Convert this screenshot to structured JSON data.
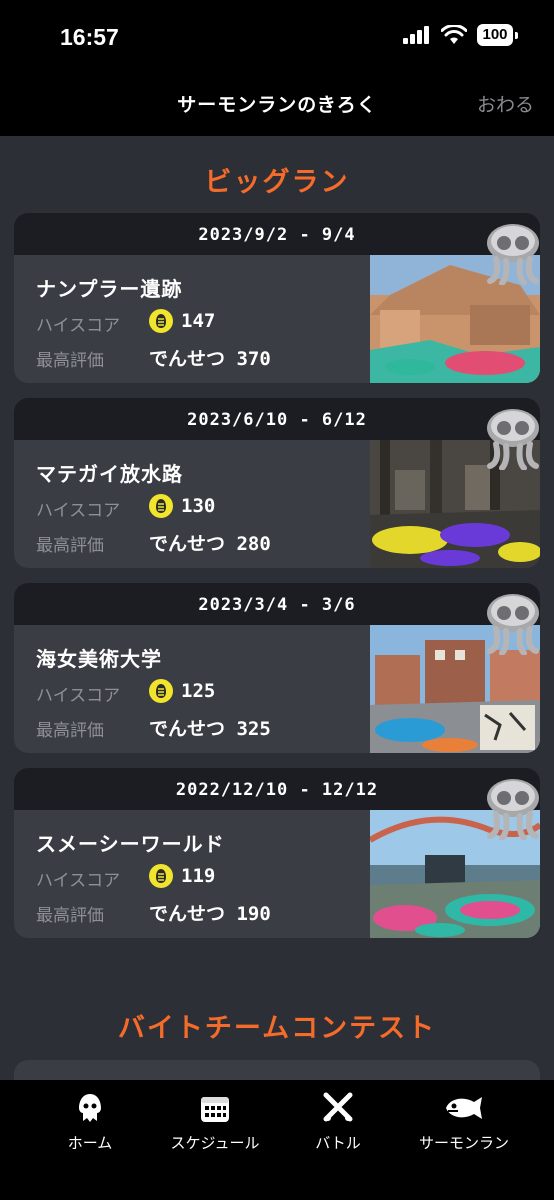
{
  "status": {
    "time": "16:57",
    "battery": "100"
  },
  "nav": {
    "title": "サーモンランのきろく",
    "close_label": "おわる"
  },
  "sections": {
    "big_run": "ビッグラン",
    "eggstra": "バイトチームコンテスト"
  },
  "labels": {
    "high_score": "ハイスコア",
    "best_rank": "最高評価"
  },
  "records": [
    {
      "date": "2023/9/2 - 9/4",
      "stage": "ナンプラー遺跡",
      "high_score": "147",
      "best_rank": "でんせつ 370"
    },
    {
      "date": "2023/6/10 - 6/12",
      "stage": "マテガイ放水路",
      "high_score": "130",
      "best_rank": "でんせつ 280"
    },
    {
      "date": "2023/3/4 - 3/6",
      "stage": "海女美術大学",
      "high_score": "125",
      "best_rank": "でんせつ 325"
    },
    {
      "date": "2022/12/10 - 12/12",
      "stage": "スメーシーワールド",
      "high_score": "119",
      "best_rank": "でんせつ 190"
    }
  ],
  "tabs": [
    {
      "label": "ホーム",
      "icon": "squid-icon"
    },
    {
      "label": "スケジュール",
      "icon": "calendar-icon"
    },
    {
      "label": "バトル",
      "icon": "crossed-weapons-icon"
    },
    {
      "label": "サーモンラン",
      "icon": "salmon-icon"
    }
  ],
  "colors": {
    "accent": "#f46b2a",
    "background": "#2c2f35",
    "card": "#3a3d44",
    "egg": "#f0e42d"
  }
}
